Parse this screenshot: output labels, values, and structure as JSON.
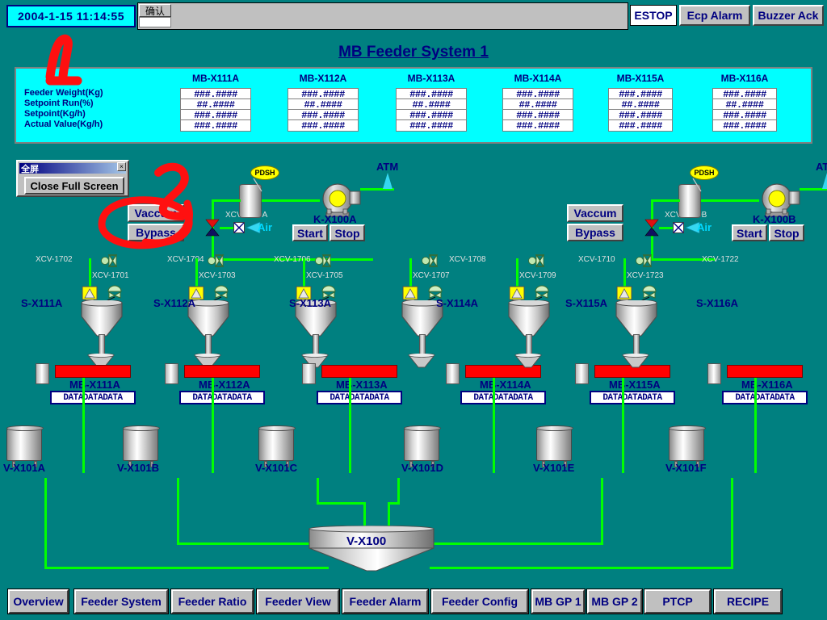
{
  "header": {
    "datetime": "2004-1-15   11:14:55",
    "ack_button": "确认",
    "estop": "ESTOP",
    "ecp_alarm": "Ecp Alarm",
    "buzzer_ack": "Buzzer Ack"
  },
  "title": "MB Feeder System 1",
  "data_table": {
    "row_labels": [
      "Feeder Weight(Kg)",
      "Setpoint Run(%)",
      "Setpoint(Kg/h)",
      "Actual Value(Kg/h)"
    ],
    "columns": [
      "MB-X111A",
      "MB-X112A",
      "MB-X113A",
      "MB-X114A",
      "MB-X115A",
      "MB-X116A"
    ],
    "values": [
      [
        "###.####",
        "##.####",
        "###.####",
        "###.####"
      ],
      [
        "###.####",
        "##.####",
        "###.####",
        "###.####"
      ],
      [
        "###.####",
        "##.####",
        "###.####",
        "###.####"
      ],
      [
        "###.####",
        "##.####",
        "###.####",
        "###.####"
      ],
      [
        "###.####",
        "##.####",
        "###.####",
        "###.####"
      ],
      [
        "###.####",
        "##.####",
        "###.####",
        "###.####"
      ]
    ]
  },
  "fullscreen_dialog": {
    "title": "全屏",
    "close_icon": "close-icon",
    "button": "Close Full Screen"
  },
  "trains": [
    {
      "vaccum": "Vaccum",
      "bypass": "Bypass",
      "valve_tag": "XCV-1700A",
      "air_label": "Air",
      "pdsh": "PDSH",
      "blower_tag": "K-X100A",
      "start": "Start",
      "stop": "Stop",
      "atm": "ATM"
    },
    {
      "vaccum": "Vaccum",
      "bypass": "Bypass",
      "valve_tag": "XCV-1700B",
      "air_label": "Air",
      "pdsh": "PDSH",
      "blower_tag": "K-X100B",
      "start": "Start",
      "stop": "Stop",
      "atm": "ATM"
    }
  ],
  "lines": [
    {
      "top_valve": "XCV-1702",
      "silo_valve": "XCV-1701",
      "silo_tag": "S-X111A",
      "feeder_tag": "MB-X111A",
      "data_value": "DATADATADATA",
      "tank_tag": "V-X101A"
    },
    {
      "top_valve": "XCV-1704",
      "silo_valve": "XCV-1703",
      "silo_tag": "S-X112A",
      "feeder_tag": "MB-X112A",
      "data_value": "DATADATADATA",
      "tank_tag": "V-X101B"
    },
    {
      "top_valve": "XCV-1706",
      "silo_valve": "XCV-1705",
      "silo_tag": "S-X113A",
      "feeder_tag": "MB-X113A",
      "data_value": "DATADATADATA",
      "tank_tag": "V-X101C"
    },
    {
      "top_valve": "XCV-1708",
      "silo_valve": "XCV-1707",
      "silo_tag": "S-X114A",
      "feeder_tag": "MB-X114A",
      "data_value": "DATADATADATA",
      "tank_tag": "V-X101D"
    },
    {
      "top_valve": "XCV-1710",
      "silo_valve": "XCV-1709",
      "silo_tag": "S-X115A",
      "feeder_tag": "MB-X115A",
      "data_value": "DATADATADATA",
      "tank_tag": "V-X101E"
    },
    {
      "top_valve": "XCV-1722",
      "silo_valve": "XCV-1723",
      "silo_tag": "S-X116A",
      "feeder_tag": "MB-X116A",
      "data_value": "DATADATADATA",
      "tank_tag": "V-X101F"
    }
  ],
  "main_vessel": "V-X100",
  "nav": [
    "Overview",
    "Feeder System",
    "Feeder Ratio",
    "Feeder View",
    "Feeder Alarm",
    "Feeder  Config",
    "MB GP 1",
    "MB GP 2",
    "PTCP",
    "RECIPE"
  ],
  "annotations": [
    {
      "mark": "1"
    },
    {
      "mark": "2"
    }
  ],
  "colors": {
    "background": "#008080",
    "panel": "#00ffff",
    "pipe": "#00ff00",
    "text": "#000080",
    "button_face": "#c0c0c0",
    "feeder": "#ff0000",
    "annotation": "#ff0000"
  }
}
